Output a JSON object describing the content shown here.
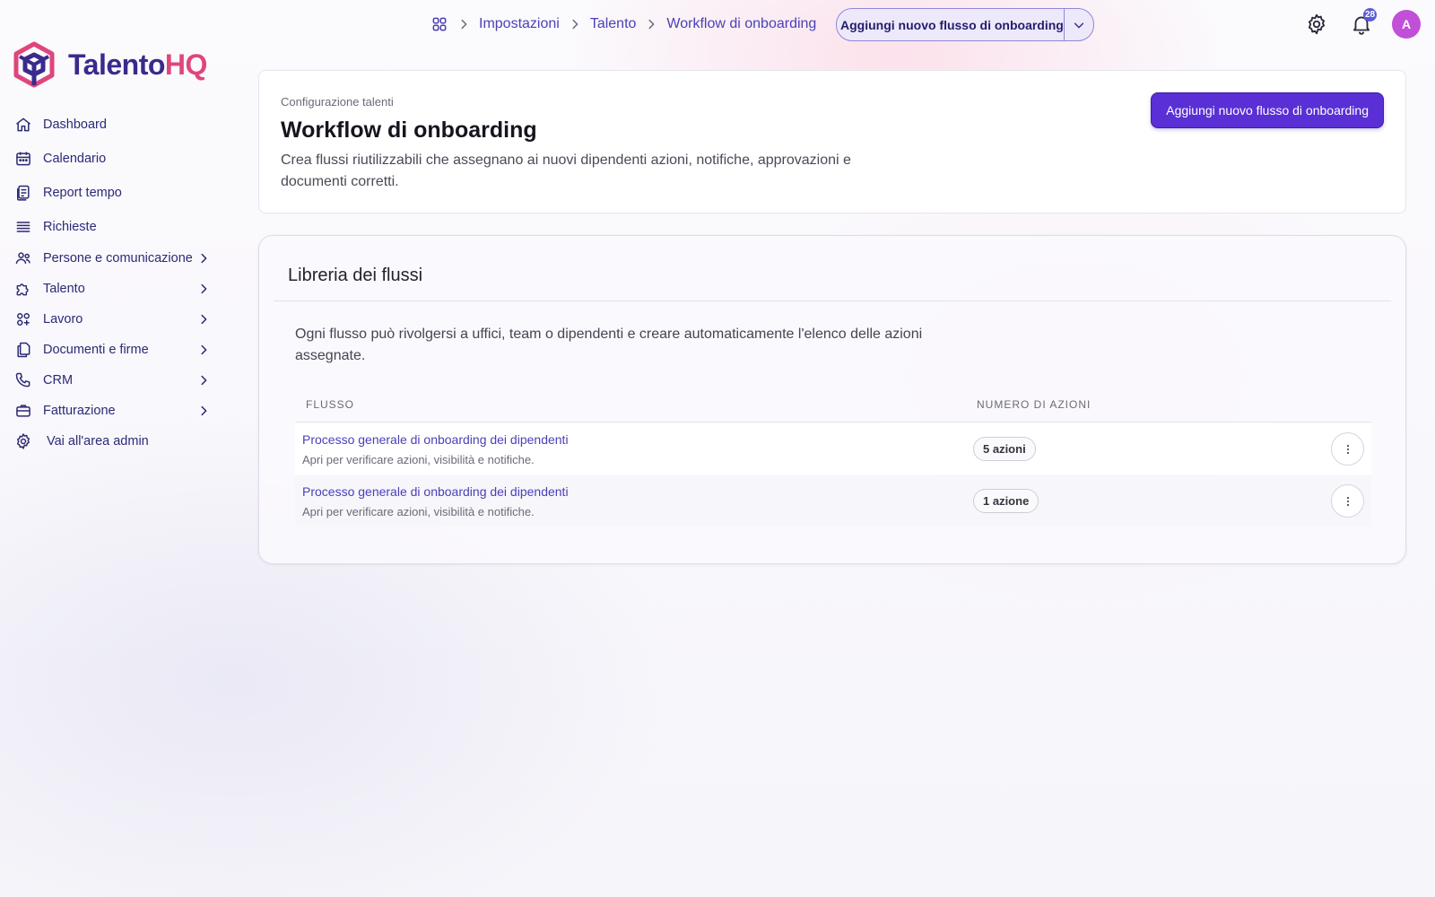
{
  "brand": {
    "name_part1": "Talento",
    "name_part2": "HQ",
    "colors": {
      "primary": "#3b2a8c",
      "accent": "#e0457b",
      "button": "#5a2fd6"
    }
  },
  "sidebar": {
    "items": [
      {
        "label": "Dashboard",
        "icon": "home-icon",
        "has_chevron": false
      },
      {
        "label": "Calendario",
        "icon": "calendar-icon",
        "has_chevron": false
      },
      {
        "label": "Report tempo",
        "icon": "report-icon",
        "has_chevron": false
      },
      {
        "label": "Richieste",
        "icon": "list-icon",
        "has_chevron": false
      },
      {
        "label": "Persone e comunicazione",
        "icon": "people-icon",
        "has_chevron": true
      },
      {
        "label": "Talento",
        "icon": "puzzle-icon",
        "has_chevron": true
      },
      {
        "label": "Lavoro",
        "icon": "apps-icon",
        "has_chevron": true
      },
      {
        "label": "Documenti e firme",
        "icon": "documents-icon",
        "has_chevron": true
      },
      {
        "label": "CRM",
        "icon": "phone-icon",
        "has_chevron": true
      },
      {
        "label": "Fatturazione",
        "icon": "briefcase-icon",
        "has_chevron": true
      },
      {
        "label": "Vai all'area admin",
        "icon": "gear-icon",
        "has_chevron": false
      }
    ]
  },
  "topbar": {
    "breadcrumb": [
      "Impostazioni",
      "Talento",
      "Workflow di onboarding"
    ],
    "split_button_label": "Aggiungi nuovo flusso di onboarding",
    "notification_count": "28",
    "avatar_initial": "A"
  },
  "header": {
    "eyebrow": "Configurazione talenti",
    "title": "Workflow di onboarding",
    "description": "Crea flussi riutilizzabili che assegnano ai nuovi dipendenti azioni, notifiche, approvazioni e documenti corretti.",
    "primary_button": "Aggiungi nuovo flusso di onboarding"
  },
  "library": {
    "title": "Libreria dei flussi",
    "description": "Ogni flusso può rivolgersi a uffici, team o dipendenti e creare automaticamente l'elenco delle azioni assegnate.",
    "columns": [
      "Flusso",
      "Numero di azioni"
    ],
    "rows": [
      {
        "name": "Processo generale di onboarding dei dipendenti",
        "subtitle": "Apri per verificare azioni, visibilità e notifiche.",
        "count": "5 azioni"
      },
      {
        "name": "Processo generale di onboarding dei dipendenti",
        "subtitle": "Apri per verificare azioni, visibilità e notifiche.",
        "count": "1 azione"
      }
    ]
  }
}
